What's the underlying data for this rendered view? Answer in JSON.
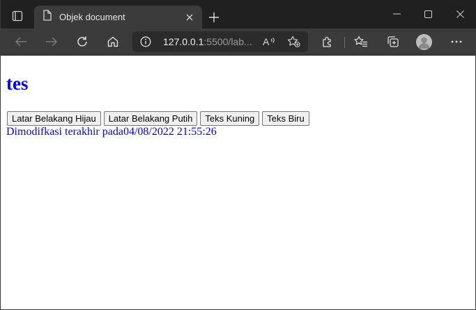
{
  "browser": {
    "tab": {
      "title": "Objek document"
    },
    "address": {
      "host": "127.0.0.1",
      "rest": ":5500/lab..."
    }
  },
  "page": {
    "heading": "tes",
    "buttons": [
      {
        "label": "Latar Belakang Hijau"
      },
      {
        "label": "Latar Belakang Putih"
      },
      {
        "label": "Teks Kuning"
      },
      {
        "label": "Teks Biru"
      }
    ],
    "modified_prefix": "Dimodifkasi terakhir pada",
    "modified_date": "04/08/2022 21:55:26"
  },
  "colors": {
    "chrome_dark": "#202020",
    "toolbar": "#3b3b3b",
    "page_text": "#0000ff"
  },
  "icons": [
    "tab-actions-icon",
    "page-icon",
    "close-icon",
    "plus-icon",
    "minimize-icon",
    "maximize-icon",
    "window-close-icon",
    "back-icon",
    "forward-icon",
    "refresh-icon",
    "home-icon",
    "info-icon",
    "read-aloud-icon",
    "add-favorite-icon",
    "extensions-icon",
    "favorites-icon",
    "collections-icon",
    "profile-icon",
    "more-icon"
  ]
}
